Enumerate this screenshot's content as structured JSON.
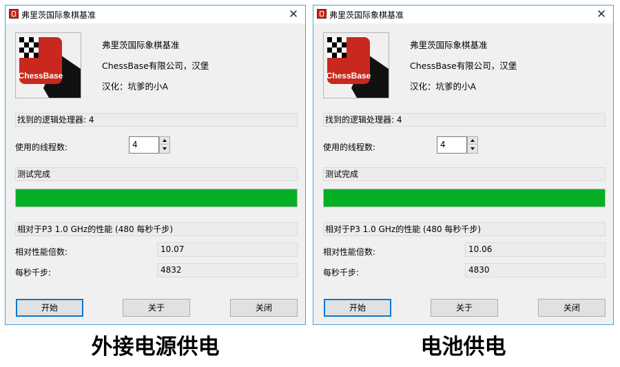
{
  "colors": {
    "progress": "#06b025",
    "titlebar_border": "#4a9fd8",
    "default_button": "#0078d7"
  },
  "dialogs": [
    {
      "title": "弗里茨国际象棋基准",
      "close_icon": "close-icon",
      "logo_text": "ChessBase",
      "info": [
        "弗里茨国际象棋基准",
        "ChessBase有限公司，汉堡",
        "汉化：坑爹的小A"
      ],
      "processors_text": "找到的逻辑处理器: 4",
      "threads_label": "使用的线程数:",
      "threads_value": "4",
      "status_text": "测试完成",
      "progress": 1.0,
      "relative_text": "相对于P3 1.0 GHz的性能 (480 每秒千步)",
      "ratio_label": "相对性能倍数:",
      "ratio_value": "10.07",
      "kns_label": "每秒千步:",
      "kns_value": "4832",
      "buttons": {
        "start": "开始",
        "about": "关于",
        "close": "关闭"
      }
    },
    {
      "title": "弗里茨国际象棋基准",
      "close_icon": "close-icon",
      "logo_text": "ChessBase",
      "info": [
        "弗里茨国际象棋基准",
        "ChessBase有限公司，汉堡",
        "汉化：坑爹的小A"
      ],
      "processors_text": "找到的逻辑处理器: 4",
      "threads_label": "使用的线程数:",
      "threads_value": "4",
      "status_text": "测试完成",
      "progress": 1.0,
      "relative_text": "相对于P3 1.0 GHz的性能 (480 每秒千步)",
      "ratio_label": "相对性能倍数:",
      "ratio_value": "10.06",
      "kns_label": "每秒千步:",
      "kns_value": "4830",
      "buttons": {
        "start": "开始",
        "about": "关于",
        "close": "关闭"
      }
    }
  ],
  "captions": [
    "外接电源供电",
    "电池供电"
  ]
}
